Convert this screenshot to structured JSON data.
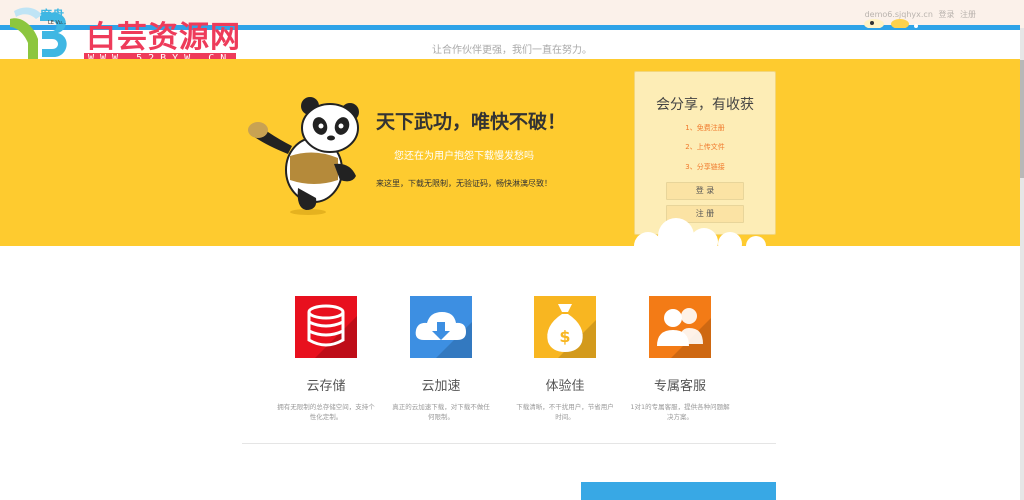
{
  "header": {
    "brand": "度盘",
    "brand_small": "LE Vu...",
    "links": [
      "demo6.sjqhyx.cn",
      "登录",
      "注册"
    ]
  },
  "logo": {
    "title": "白芸资源网",
    "subtitle": "WWW.52BYW.CN"
  },
  "tagline": "让合作伙伴更强，我们一直在努力。",
  "banner": {
    "headline": "天下武功，唯快不破！",
    "subline": "您还在为用户抱怨下载慢发愁吗",
    "desc": "来这里，下载无限制，无验证码，畅快淋漓尽致！"
  },
  "card": {
    "title": "会分享，有收获",
    "steps": [
      "1、免费注册",
      "2、上传文件",
      "3、分享链接"
    ],
    "login_label": "登 录",
    "register_label": "注 册"
  },
  "features": [
    {
      "title": "云存储",
      "text": "拥有无限制的总存储空间，支持个性化定制。",
      "icon": "database-icon",
      "color": "#e8101e"
    },
    {
      "title": "云加速",
      "text": "真正的云加速下载，对下载不做任何限制。",
      "icon": "cloud-download-icon",
      "color": "#3d8fe2"
    },
    {
      "title": "体验佳",
      "text": "下载清晰，不干扰用户，节省用户时间。",
      "icon": "money-bag-icon",
      "color": "#f8b621"
    },
    {
      "title": "专属客服",
      "text": "1对1的专属客服，提供各种问题解决方案。",
      "icon": "customer-service-icon",
      "color": "#f37b16"
    }
  ],
  "colors": {
    "banner": "#fecb2f",
    "accent_blue": "#2ea3e8",
    "logo_red": "#ee3b5a"
  }
}
